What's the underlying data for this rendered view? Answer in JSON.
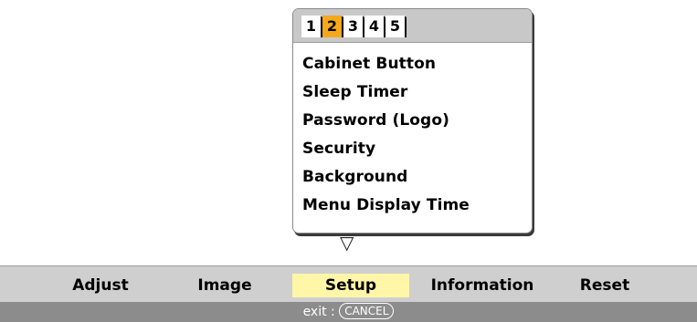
{
  "popup": {
    "tabs": [
      "1",
      "2",
      "3",
      "4",
      "5"
    ],
    "active_tab": "2",
    "items": [
      "Cabinet Button",
      "Sleep Timer",
      "Password (Logo)",
      "Security",
      "Background",
      "Menu Display Time"
    ],
    "scroll_indicator": "▽"
  },
  "menubar": {
    "items": [
      "Adjust",
      "Image",
      "Setup",
      "Information",
      "Reset"
    ],
    "active": "Setup"
  },
  "footer": {
    "exit_label": "exit : ",
    "cancel_key": "CANCEL"
  },
  "colors": {
    "active_tab": "#f5a81b",
    "active_menu": "#fff6a8",
    "menubar_bg": "#cfcfcf",
    "footer_bg": "#8c8c8c"
  }
}
